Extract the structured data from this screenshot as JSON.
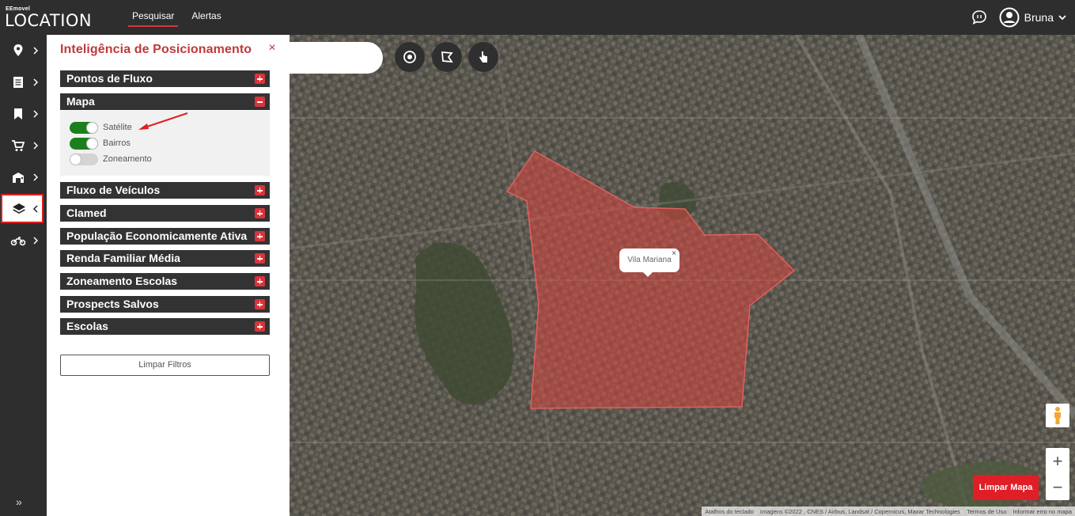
{
  "brand": {
    "small": "EEmovel",
    "big": "LOCATION"
  },
  "nav": {
    "items": [
      {
        "label": "Pesquisar",
        "active": true
      },
      {
        "label": "Alertas",
        "active": false
      }
    ]
  },
  "user": {
    "name": "Bruna"
  },
  "rail": {
    "items": [
      {
        "icon": "map-pin-icon"
      },
      {
        "icon": "document-icon"
      },
      {
        "icon": "bookmark-icon"
      },
      {
        "icon": "cart-icon"
      },
      {
        "icon": "buildings-icon"
      },
      {
        "icon": "layers-icon",
        "active": true
      },
      {
        "icon": "motorcycle-icon"
      }
    ],
    "collapse": "»"
  },
  "panel": {
    "title": "Inteligência de Posicionamento",
    "close": "×",
    "sections": [
      "Pontos de Fluxo",
      "Mapa",
      "Fluxo de Veículos",
      "Clamed",
      "População Economicamente Ativa",
      "Renda Familiar Média",
      "Zoneamento Escolas",
      "Prospects Salvos",
      "Escolas"
    ],
    "toggles": [
      {
        "label": "Satélite",
        "on": true
      },
      {
        "label": "Bairros",
        "on": true
      },
      {
        "label": "Zoneamento",
        "on": false
      }
    ],
    "clear_button": "Limpar Filtros"
  },
  "map": {
    "tooltip": "Vila Mariana",
    "tooltip_close": "×",
    "limpar_mapa": "Limpar Mapa",
    "zoom_in": "+",
    "zoom_out": "−",
    "attribution": [
      "Atalhos do teclado",
      "Imagens ©2022 , CNES / Airbus, Landsat / Copernicus, Maxar Technologies",
      "Termos de Uso",
      "Informar erro no mapa"
    ],
    "colors": {
      "overlay": "#d9463f"
    }
  }
}
